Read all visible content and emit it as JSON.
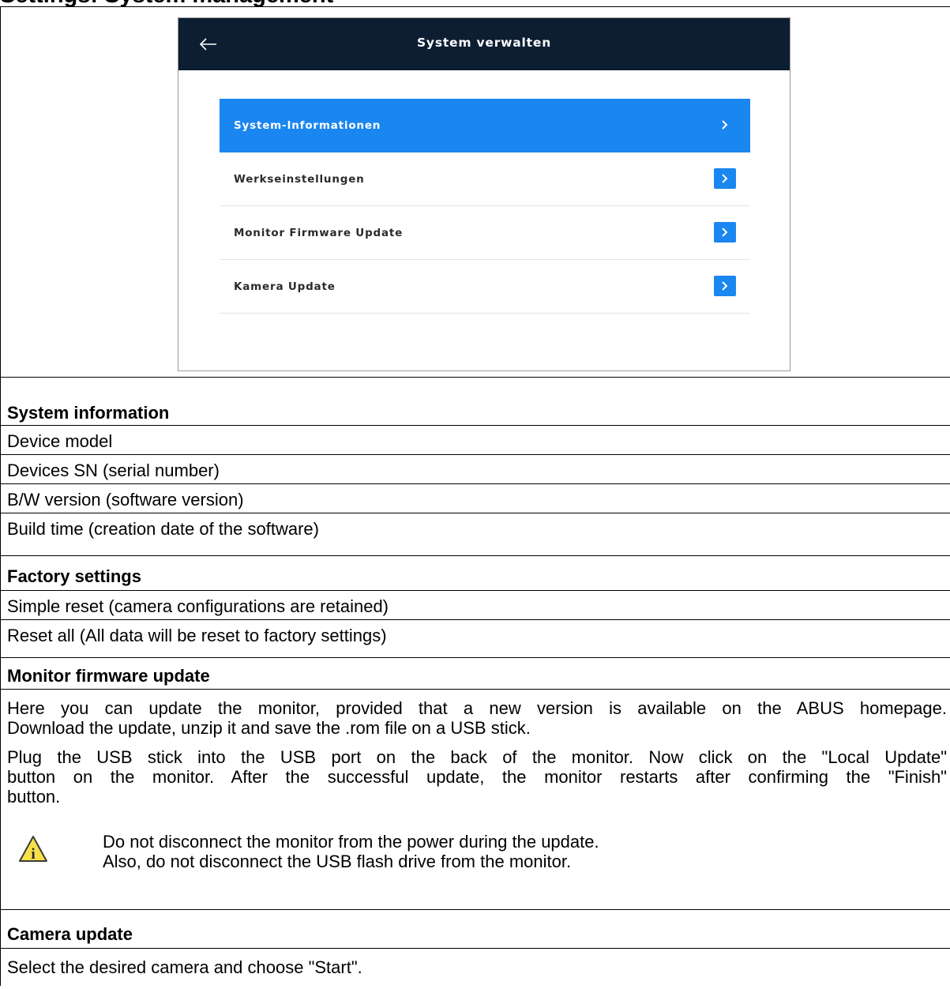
{
  "page_title": "Settings: System management",
  "screen": {
    "title": "System verwalten",
    "menu": [
      {
        "label": "System-Informationen",
        "active": true
      },
      {
        "label": "Werkseinstellungen",
        "active": false
      },
      {
        "label": "Monitor Firmware Update",
        "active": false
      },
      {
        "label": "Kamera Update",
        "active": false
      }
    ]
  },
  "system_information": {
    "heading": "System information",
    "items": [
      "Device model",
      "Devices SN (serial number)",
      "B/W version (software version)",
      "Build time (creation date of the software)"
    ]
  },
  "factory_settings": {
    "heading": "Factory settings",
    "items": [
      "Simple reset (camera configurations are retained)",
      "Reset all (All data will be reset to factory settings)"
    ]
  },
  "monitor_firmware_update": {
    "heading": "Monitor firmware update",
    "para1_line1": "Here you can update the monitor, provided that a new version is available on the ABUS homepage.",
    "para1_line2": "Download the update, unzip it and save the .rom file on a USB stick.",
    "para2_line1": "Plug the USB stick into the USB port on the back of the monitor. Now click on the \"Local Update\"",
    "para2_line2": "button on the monitor. After the successful update, the monitor restarts after confirming the \"Finish\"",
    "para2_line3": "button.",
    "warning_line1": "Do not disconnect the monitor from the power during the update.",
    "warning_line2": "Also, do not disconnect the USB flash drive from the monitor."
  },
  "camera_update": {
    "heading": "Camera update",
    "text": "Select the desired camera and choose \"Start\"."
  }
}
